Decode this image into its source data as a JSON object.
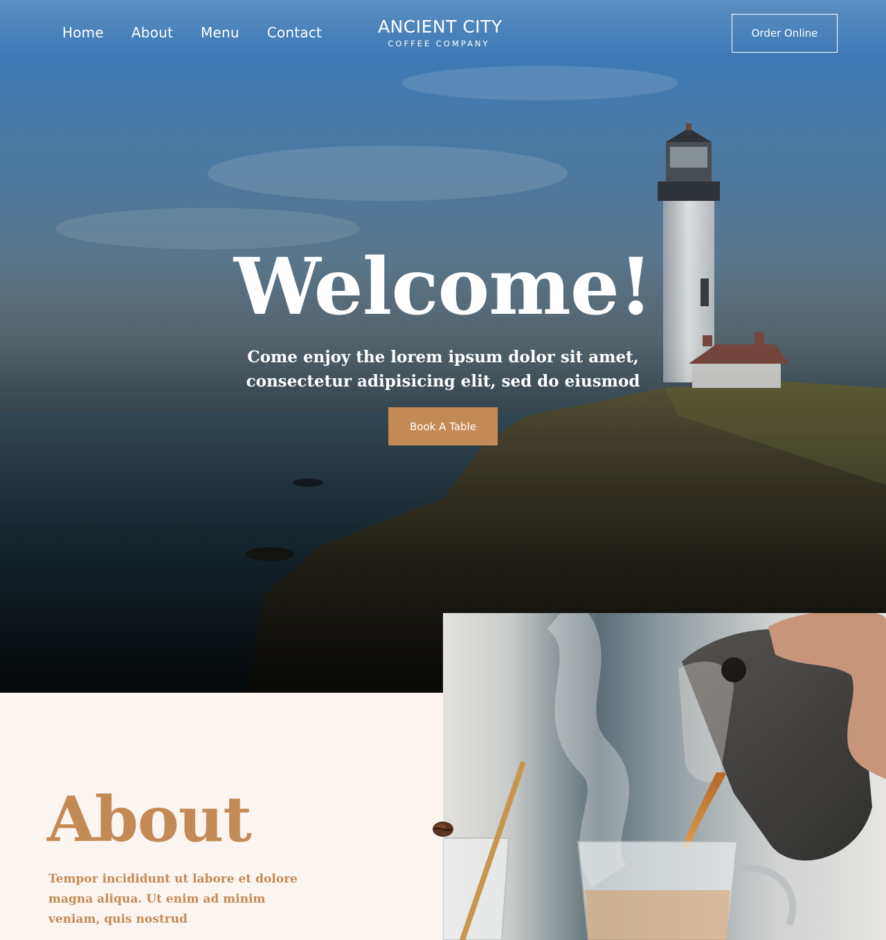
{
  "nav": {
    "items": [
      {
        "label": "Home"
      },
      {
        "label": "About"
      },
      {
        "label": "Menu"
      },
      {
        "label": "Contact"
      }
    ]
  },
  "logo": {
    "brand": "ANCIENT CITY",
    "subtitle": "COFFEE COMPANY"
  },
  "header": {
    "order_label": "Order Online"
  },
  "hero": {
    "title": "Welcome!",
    "subtitle": "Come enjoy the lorem ipsum dolor sit amet, consectetur adipisicing elit, sed do eiusmod",
    "cta_label": "Book A Table"
  },
  "about": {
    "title": "About",
    "text": "Tempor incididunt ut labore et dolore magna aliqua. Ut enim ad minim veniam, quis nostrud"
  },
  "colors": {
    "accent": "#c48a55",
    "panel_background": "#fbf4ef",
    "text_light": "#ffffff"
  }
}
